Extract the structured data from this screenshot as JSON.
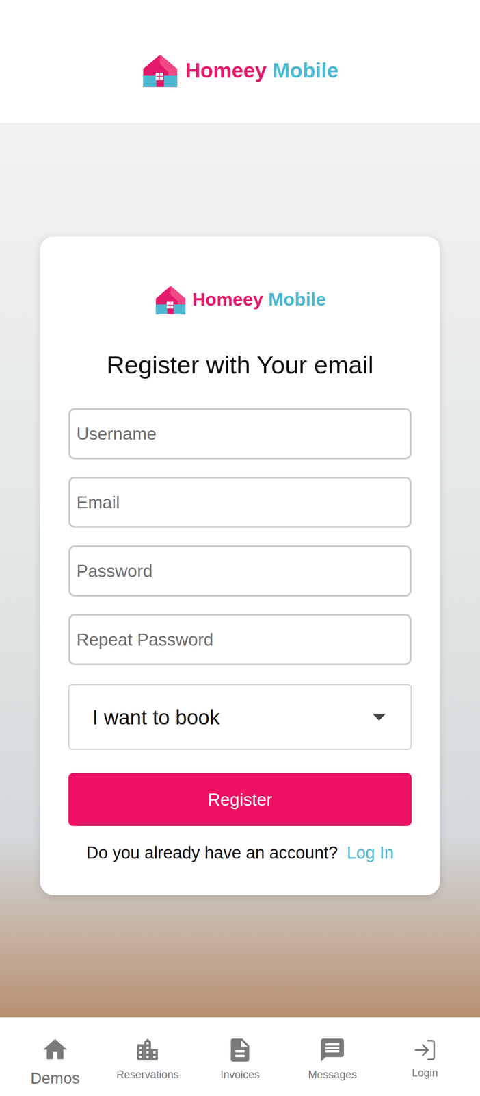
{
  "header": {
    "logo": {
      "brand": "Homeey",
      "product": "Mobile"
    }
  },
  "card": {
    "logo": {
      "brand": "Homeey",
      "product": "Mobile"
    },
    "title": "Register with Your email",
    "fields": [
      {
        "placeholder": "Username",
        "kind": "text"
      },
      {
        "placeholder": "Email",
        "kind": "email"
      },
      {
        "placeholder": "Password",
        "kind": "password"
      },
      {
        "placeholder": "Repeat Password",
        "kind": "password"
      }
    ],
    "select": {
      "value": "I want to book"
    },
    "submit": "Register",
    "footer": {
      "prompt": "Do you already have an account?",
      "link": "Log In"
    }
  },
  "nav": [
    {
      "label": "Demos",
      "selected": true
    },
    {
      "label": "Reservations",
      "selected": false
    },
    {
      "label": "Invoices",
      "selected": false
    },
    {
      "label": "Messages",
      "selected": false
    },
    {
      "label": "Login",
      "selected": false
    }
  ]
}
